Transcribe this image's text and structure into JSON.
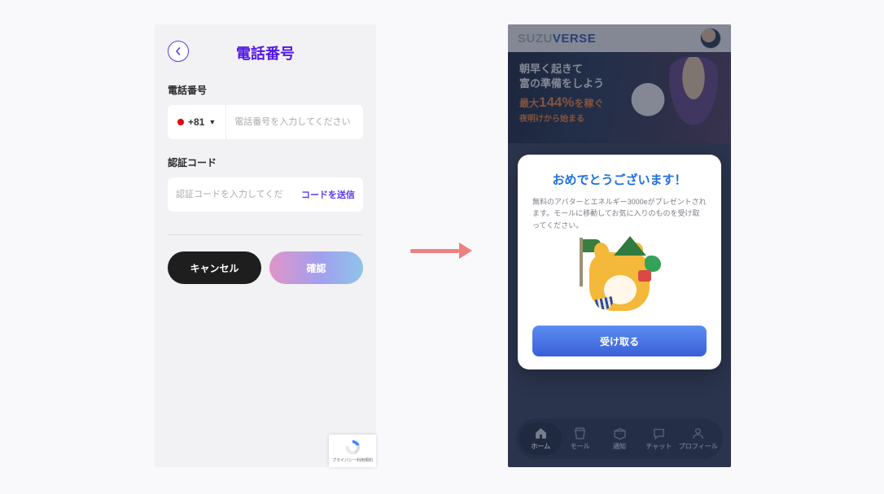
{
  "left": {
    "title": "電話番号",
    "phone_label": "電話番号",
    "country_code": "+81",
    "phone_placeholder": "電話番号を入力してください",
    "code_label": "認証コード",
    "code_placeholder": "認証コードを入力してくだ",
    "send_code": "コードを送信",
    "cancel": "キャンセル",
    "confirm": "確認",
    "recaptcha": "プライバシー利用規約"
  },
  "right": {
    "brand_left": "SUZU",
    "brand_right": "VERSE",
    "banner": {
      "line1": "朝早く起きて",
      "line2": "富の準備をしよう",
      "line3_prefix": "最大",
      "line3_pct": "144%",
      "line3_suffix": "を稼ぐ",
      "line4": "夜明けから始まる"
    },
    "modal": {
      "title": "おめでとうございます！",
      "text": "無料のアバターとエネルギー3000eがプレゼントされます。モールに移動してお気に入りのものを受け取ってください。",
      "button": "受け取る"
    },
    "nav": {
      "home": "ホーム",
      "mall": "モール",
      "notifications": "通知",
      "chat": "チャット",
      "profile": "プロフィール"
    }
  }
}
